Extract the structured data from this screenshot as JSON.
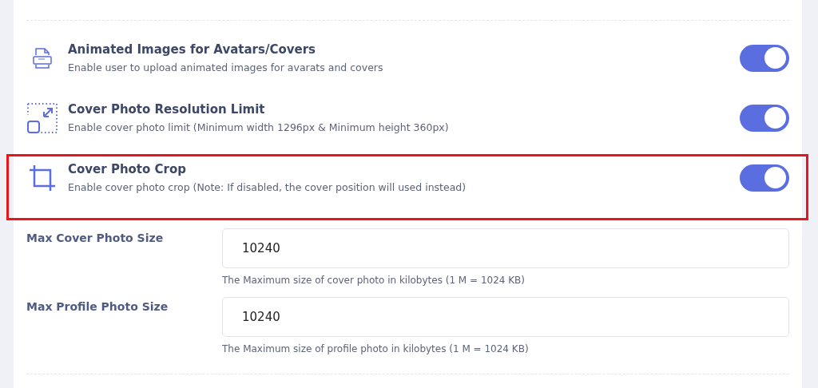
{
  "settings": [
    {
      "title": "Animated Images for Avatars/Covers",
      "description": "Enable user to upload animated images for avarats and covers",
      "on": true,
      "highlighted": false
    },
    {
      "title": "Cover Photo Resolution Limit",
      "description": "Enable cover photo limit (Minimum width 1296px & Minimum height 360px)",
      "on": true,
      "highlighted": false
    },
    {
      "title": "Cover Photo Crop",
      "description": "Enable cover photo crop (Note: If disabled, the cover position will used instead)",
      "on": true,
      "highlighted": true
    }
  ],
  "fields": [
    {
      "label": "Max Cover Photo Size",
      "value": "10240",
      "help": "The Maximum size of cover photo in kilobytes (1 M = 1024 KB)"
    },
    {
      "label": "Max Profile Photo Size",
      "value": "10240",
      "help": "The Maximum size of profile photo in kilobytes (1 M = 1024 KB)"
    }
  ]
}
